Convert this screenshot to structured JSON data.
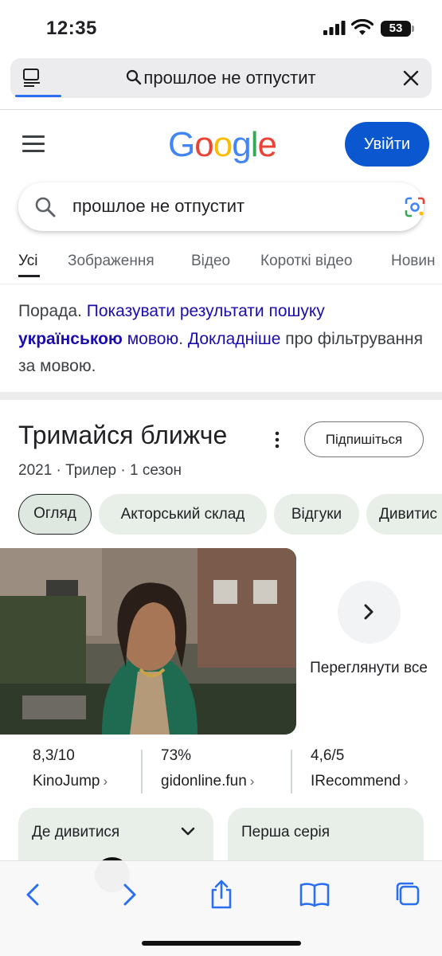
{
  "status_bar": {
    "time": "12:35",
    "battery": "53"
  },
  "address_bar": {
    "query": "прошлое не отпустит"
  },
  "google": {
    "logo_letters": [
      "G",
      "o",
      "o",
      "g",
      "l",
      "e"
    ],
    "signin_label": "Увійти"
  },
  "search": {
    "value": "прошлое не отпустит"
  },
  "tabs": [
    {
      "label": "Усі",
      "active": true
    },
    {
      "label": "Зображення"
    },
    {
      "label": "Відео"
    },
    {
      "label": "Короткі відео"
    },
    {
      "label": "Новин"
    }
  ],
  "tip": {
    "prefix": "Порада. ",
    "link1": "Показувати результати пошуку ",
    "link1_bold": "українською",
    "link1_end": " мовою",
    "middle": ". ",
    "link2": "Докладніше",
    "suffix": " про фільтрування за мовою."
  },
  "knowledge_panel": {
    "title": "Тримайся ближче",
    "subscribe_label": "Підпишіться",
    "meta": "2021 · Трилер · 1 сезон",
    "chips": [
      "Огляд",
      "Акторський склад",
      "Відгуки",
      "Дивитис"
    ],
    "view_all": "Переглянути все",
    "ratings": [
      {
        "score": "8,3/10",
        "source": "KinoJump"
      },
      {
        "score": "73%",
        "source": "gidonline.fun"
      },
      {
        "score": "4,6/5",
        "source": "IRecommend"
      }
    ],
    "cards": [
      {
        "label": "Де дивитися"
      },
      {
        "label": "Перша серія"
      }
    ]
  },
  "colors": {
    "google_blue": "#0b57d0",
    "link": "#1a0dab",
    "chip_bg": "#e7efe8"
  }
}
